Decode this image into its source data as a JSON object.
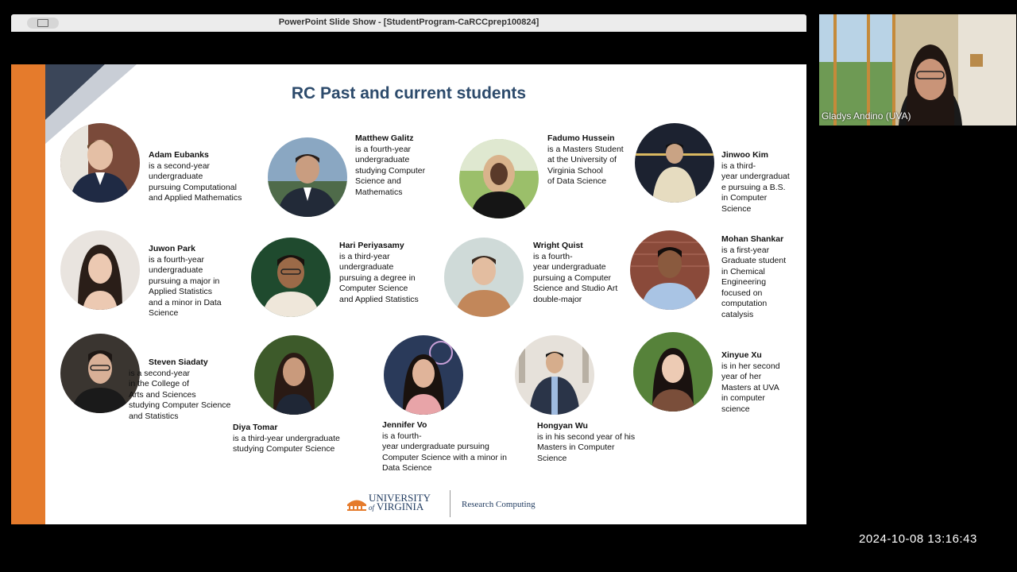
{
  "window": {
    "title": "PowerPoint Slide Show - [StudentProgram-CaRCCprep100824]"
  },
  "slide": {
    "title": "RC Past and current students",
    "students": [
      {
        "name": "Adam Eubanks",
        "desc": "is a second-year\nundergraduate\npursuing  Computational\nand Applied Mathematics"
      },
      {
        "name": "Matthew Galitz",
        "desc": " is a fourth-year\nundergraduate\nstudying Computer\nScience and\nMathematics"
      },
      {
        "name": "Fadumo Hussein",
        "desc": "is a Masters Student\nat the University of\nVirginia School\nof Data Science"
      },
      {
        "name": "Jinwoo Kim",
        "desc": "is a third-\nyear undergraduat\ne pursuing a B.S.\nin Computer\nScience"
      },
      {
        "name": "Juwon Park",
        "desc": " is a fourth-year\nundergraduate\npursuing a major in\nApplied Statistics\nand a minor in Data\nScience"
      },
      {
        "name": "Hari Periyasamy",
        "desc": "is a third-year\nundergraduate\npursuing a degree in\nComputer Science\nand Applied Statistics"
      },
      {
        "name": "Wright Quist",
        "desc": "is a fourth-\nyear undergraduate\npursuing a Computer\nScience and Studio Art\ndouble-major"
      },
      {
        "name": "Mohan Shankar",
        "desc": " is a first-year\nGraduate student\nin Chemical\nEngineering\nfocused on\ncomputation\ncatalysis"
      },
      {
        "name": "Steven Siadaty",
        "desc": " is a second-year\nin the College of\nArts and Sciences\nstudying Computer Science\nand Statistics"
      },
      {
        "name": "Diya Tomar",
        "desc": " is a third-year undergraduate\nstudying Computer Science"
      },
      {
        "name": "Jennifer Vo",
        "desc": "is a fourth-\nyear undergraduate pursuing\nComputer Science with a minor in\nData Science"
      },
      {
        "name": "Hongyan Wu",
        "desc": " is in his second year of his\nMasters in  Computer\nScience"
      },
      {
        "name": "Xinyue Xu",
        "desc": "is in her second\nyear of her\nMasters at UVA\nin computer\nscience"
      }
    ],
    "footer": {
      "university": "UNIVERSITY",
      "of": "of",
      "virginia": "VIRGINIA",
      "department": "Research Computing"
    }
  },
  "webcam": {
    "participant": "Gladys Andino (UVA)"
  },
  "timestamp": "2024-10-08  13:16:43"
}
